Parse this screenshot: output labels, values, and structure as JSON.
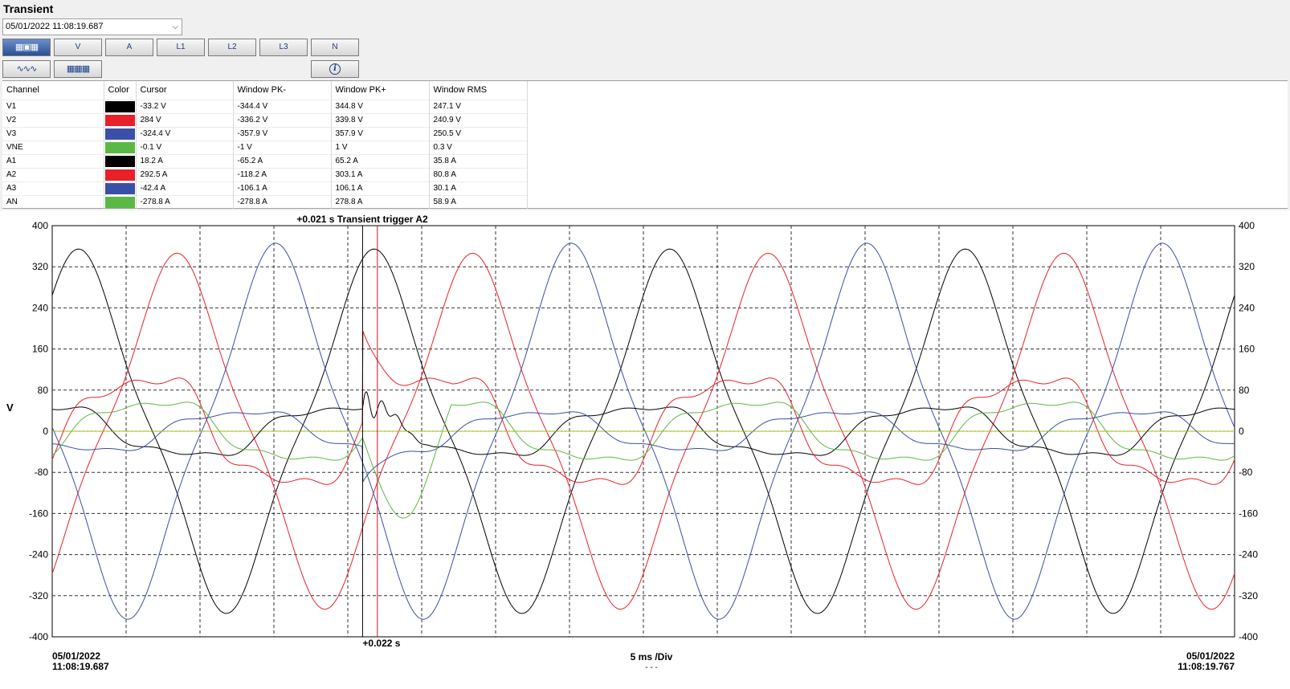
{
  "header": {
    "title": "Transient",
    "timestamp_select": "05/01/2022 11:08:19.687"
  },
  "toolbar": {
    "row1": [
      {
        "label": "",
        "icon": "multi-window-icon",
        "active": true
      },
      {
        "label": "V"
      },
      {
        "label": "A"
      },
      {
        "label": "L1"
      },
      {
        "label": "L2"
      },
      {
        "label": "L3"
      },
      {
        "label": "N"
      }
    ],
    "row2": [
      {
        "label": "",
        "icon": "waveform-icon"
      },
      {
        "label": "",
        "icon": "table-icon"
      },
      {
        "label": "",
        "icon": "info-icon"
      }
    ]
  },
  "table": {
    "headers": [
      "Channel",
      "Color",
      "Cursor",
      "Window PK-",
      "Window PK+",
      "Window RMS"
    ],
    "rows": [
      {
        "channel": "V1",
        "color": "#000000",
        "cursor": "-33.2 V",
        "pk_minus": "-344.4 V",
        "pk_plus": "344.8 V",
        "rms": "247.1 V"
      },
      {
        "channel": "V2",
        "color": "#e8202a",
        "cursor": "284 V",
        "pk_minus": "-336.2 V",
        "pk_plus": "339.8 V",
        "rms": "240.9 V"
      },
      {
        "channel": "V3",
        "color": "#3a4fa8",
        "cursor": "-324.4 V",
        "pk_minus": "-357.9 V",
        "pk_plus": "357.9 V",
        "rms": "250.5 V"
      },
      {
        "channel": "VNE",
        "color": "#5cb844",
        "cursor": "-0.1 V",
        "pk_minus": "-1 V",
        "pk_plus": "1 V",
        "rms": "0.3 V"
      },
      {
        "channel": "A1",
        "color": "#000000",
        "cursor": "18.2 A",
        "pk_minus": "-65.2 A",
        "pk_plus": "65.2 A",
        "rms": "35.8 A"
      },
      {
        "channel": "A2",
        "color": "#e8202a",
        "cursor": "292.5 A",
        "pk_minus": "-118.2 A",
        "pk_plus": "303.1 A",
        "rms": "80.8 A"
      },
      {
        "channel": "A3",
        "color": "#3a4fa8",
        "cursor": "-42.4 A",
        "pk_minus": "-106.1 A",
        "pk_plus": "106.1 A",
        "rms": "30.1 A"
      },
      {
        "channel": "AN",
        "color": "#5cb844",
        "cursor": "-278.8 A",
        "pk_minus": "-278.8 A",
        "pk_plus": "278.8 A",
        "rms": "58.9 A"
      }
    ]
  },
  "chart": {
    "trigger_label": "+0.021 s Transient trigger A2",
    "cursor_label": "+0.022 s",
    "y_axis_label": "V",
    "start_date": "05/01/2022",
    "start_time": "11:08:19.687",
    "end_date": "05/01/2022",
    "end_time": "11:08:19.767",
    "timebase": "5 ms /Div",
    "timebase_sub": "- - -"
  },
  "chart_data": {
    "type": "line",
    "ylim": [
      -400,
      400
    ],
    "xlim": [
      0,
      0.08
    ],
    "y_ticks": [
      "400",
      "320",
      "240",
      "160",
      "80",
      "0",
      "-80",
      "-160",
      "-240",
      "-320",
      "-400"
    ],
    "trigger_time": 0.021,
    "cursor_time": 0.022,
    "grid": true,
    "series": [
      {
        "channel": "V1",
        "color": "#000000",
        "amplitude": 345,
        "phase_deg": 58,
        "distortion": 0.12
      },
      {
        "channel": "V2",
        "color": "#e8202a",
        "amplitude": 337,
        "phase_deg": -62,
        "distortion": 0.12
      },
      {
        "channel": "V3",
        "color": "#3a4fa8",
        "amplitude": 356,
        "phase_deg": 178,
        "distortion": 0.12
      },
      {
        "channel": "VNE",
        "color": "#5cb844",
        "amplitude": 1,
        "phase_deg": 0,
        "distortion": 0
      },
      {
        "channel": "A1",
        "color": "#000000",
        "amplitude": 50,
        "phase_deg": 100,
        "distortion": 0.2
      },
      {
        "channel": "A2",
        "color": "#e8202a",
        "amplitude": 110,
        "phase_deg": -20,
        "distortion": 0.2
      },
      {
        "channel": "A3",
        "color": "#3a4fa8",
        "amplitude": 40,
        "phase_deg": 220,
        "distortion": 0.2
      },
      {
        "channel": "AN",
        "color": "#5cb844",
        "amplitude": 60,
        "phase_deg": 330,
        "distortion": 0.2
      }
    ]
  }
}
